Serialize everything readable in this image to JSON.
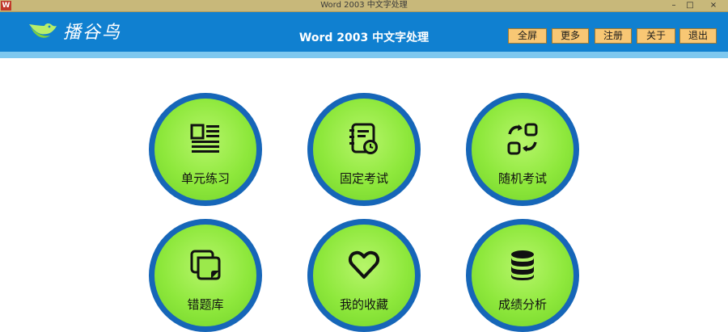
{
  "window": {
    "icon_text": "W",
    "title": "Word 2003 中文字处理",
    "minimize": "–",
    "maximize": "□",
    "close": "×"
  },
  "header": {
    "logo_text": "播谷鸟",
    "title": "Word 2003 中文字处理",
    "buttons": [
      "全屏",
      "更多",
      "注册",
      "关于",
      "退出"
    ]
  },
  "menu": [
    {
      "label": "单元练习",
      "icon": "document-icon"
    },
    {
      "label": "固定考试",
      "icon": "notebook-clock-icon"
    },
    {
      "label": "随机考试",
      "icon": "shuffle-icon"
    },
    {
      "label": "错题库",
      "icon": "stacked-pages-icon"
    },
    {
      "label": "我的收藏",
      "icon": "heart-icon"
    },
    {
      "label": "成绩分析",
      "icon": "database-icon"
    }
  ],
  "colors": {
    "header_bg": "#1080d0",
    "header_strip": "#7ec8ef",
    "button_bg": "#f8c774",
    "tile_border": "#1666b8",
    "tile_fill": "#8ee83c"
  }
}
